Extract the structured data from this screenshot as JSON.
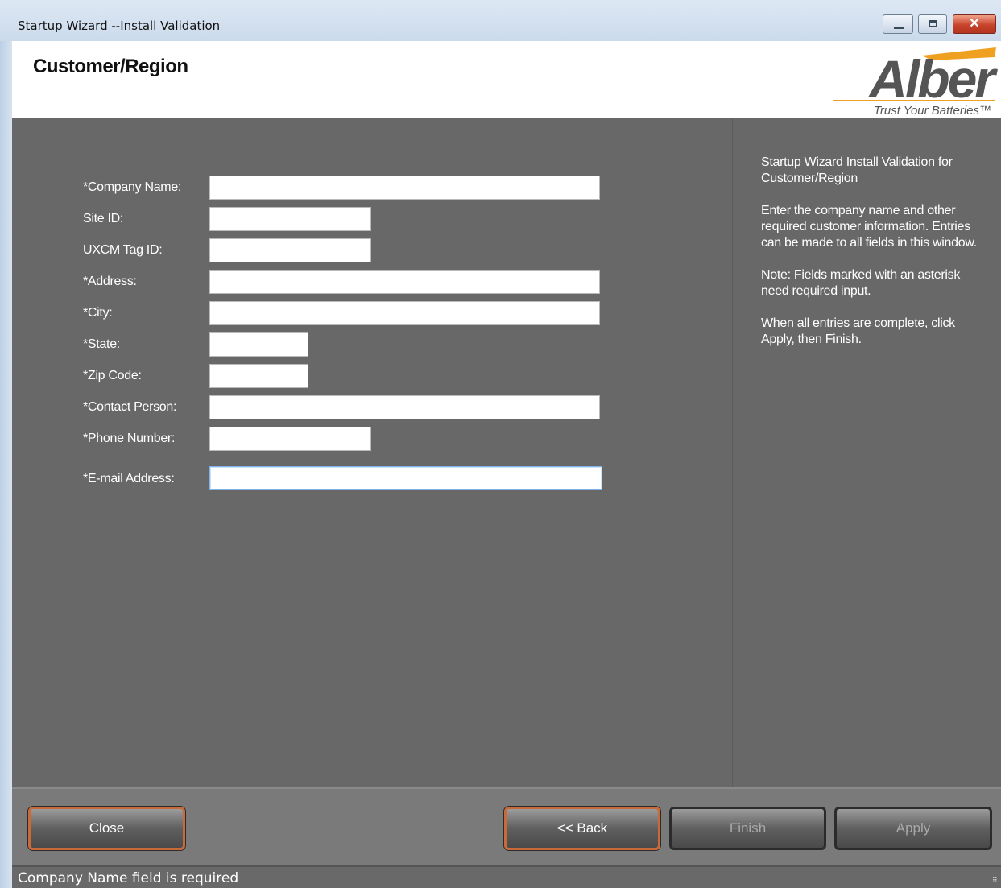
{
  "window": {
    "title": "Startup Wizard --Install Validation",
    "close_glyph": "✕"
  },
  "header": {
    "title": "Customer/Region",
    "logo": {
      "wordmark": "Alber",
      "tagline": "Trust Your Batteries™"
    }
  },
  "form": {
    "fields": [
      {
        "label": "*Company Name:",
        "value": ""
      },
      {
        "label": "Site ID:",
        "value": ""
      },
      {
        "label": "UXCM Tag ID:",
        "value": ""
      },
      {
        "label": "*Address:",
        "value": ""
      },
      {
        "label": "*City:",
        "value": ""
      },
      {
        "label": "*State:",
        "value": ""
      },
      {
        "label": "*Zip Code:",
        "value": ""
      },
      {
        "label": "*Contact Person:",
        "value": ""
      },
      {
        "label": "*Phone Number:",
        "value": ""
      },
      {
        "label": "*E-mail Address:",
        "value": ""
      }
    ]
  },
  "help": {
    "paragraphs": [
      "Startup Wizard Install Validation for Customer/Region",
      "Enter the company name and other required customer information. Entries can be made to all fields in this window.",
      "Note: Fields marked with an asterisk need required input.",
      "When all entries are complete, click Apply, then Finish."
    ]
  },
  "footer": {
    "close_label": "Close",
    "back_label": "<< Back",
    "finish_label": "Finish",
    "apply_label": "Apply"
  },
  "status": {
    "message": "Company Name field is required"
  },
  "colors": {
    "accent": "#c96a3a",
    "panel": "#686868",
    "footer": "#7a7a7a",
    "logo_gray": "#555555",
    "logo_orange": "#f0a020"
  }
}
